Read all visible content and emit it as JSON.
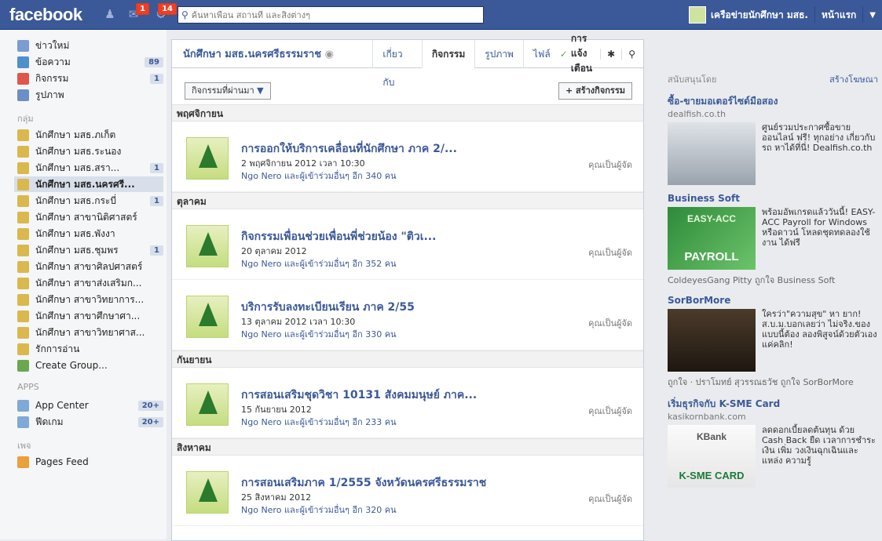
{
  "topbar": {
    "logo": "facebook",
    "friend_count": "",
    "messages_count": "1",
    "notifications_count": "14",
    "search_placeholder": "ค้นหาเพื่อน สถานที่ และสิ่งต่างๆ",
    "profile_name": "เครือข่ายนักศึกษา มสธ.",
    "home_label": "หน้าแรก"
  },
  "leftnav": {
    "items": [
      {
        "label": "ข่าวใหม่",
        "count": "",
        "icon": "news-feed-icon"
      },
      {
        "label": "ข้อความ",
        "count": "89",
        "icon": "messages-icon"
      },
      {
        "label": "กิจกรรม",
        "count": "1",
        "icon": "events-icon"
      },
      {
        "label": "รูปภาพ",
        "count": "",
        "icon": "photos-icon"
      }
    ],
    "groups_head": "กลุ่ม",
    "groups": [
      {
        "label": "นักศึกษา มสธ.ภเก็ต",
        "count": ""
      },
      {
        "label": "นักศึกษา มสธ.ระนอง",
        "count": ""
      },
      {
        "label": "นักศึกษา มสธ.สรา...",
        "count": "1"
      },
      {
        "label": "นักศึกษา มสธ.นครศรี...",
        "count": ""
      },
      {
        "label": "นักศึกษา มสธ.กระบี่",
        "count": "1"
      },
      {
        "label": "นักศึกษา สาขานิติศาสตร์",
        "count": ""
      },
      {
        "label": "นักศึกษา มสธ.พังงา",
        "count": ""
      },
      {
        "label": "นักศึกษา มสธ.ชุมพร",
        "count": "1"
      },
      {
        "label": "นักศึกษา สาขาศิลปศาสตร์",
        "count": ""
      },
      {
        "label": "นักศึกษา สาขาส่งเสริมก...",
        "count": ""
      },
      {
        "label": "นักศึกษา สาขาวิทยาการ...",
        "count": ""
      },
      {
        "label": "นักศึกษา สาขาศึกษาศา...",
        "count": ""
      },
      {
        "label": "นักศึกษา สาขาวิทยาศาส...",
        "count": ""
      },
      {
        "label": "รักการอ่าน",
        "count": ""
      },
      {
        "label": "Create Group...",
        "count": ""
      }
    ],
    "apps_head": "APPS",
    "apps": [
      {
        "label": "App Center",
        "count": "20+"
      },
      {
        "label": "ฟีดเกม",
        "count": "20+"
      }
    ],
    "pages_head": "เพจ",
    "pages": [
      {
        "label": "Pages Feed",
        "count": ""
      }
    ]
  },
  "main": {
    "page_title": "นักศึกษา มสธ.นครศรีธรรมราช",
    "tabs": [
      "เกี่ยวกับ",
      "กิจกรรม",
      "รูปภาพ",
      "ไฟล์"
    ],
    "notify_label": "การแจ้งเตือน",
    "filter_label": "กิจกรรมที่ผ่านมา",
    "create_label": "+ สร้างกิจกรรม",
    "months": [
      {
        "name": "พฤศจิกายน",
        "events": [
          {
            "title": "การออกให้บริการเคลื่อนที่นักศึกษา ภาค 2/...",
            "date": "2 พฤศจิกายน 2012 เวลา 10:30",
            "sub": "Ngo Nero และผู้เข้าร่วมอื่นๆ อีก 340 คน",
            "role": "คุณเป็นผู้จัด"
          }
        ]
      },
      {
        "name": "ตุลาคม",
        "events": [
          {
            "title": "กิจกรรมเพื่อนช่วยเพื่อนพี่ช่วยน้อง \"ติวเ...",
            "date": "20 ตุลาคม 2012",
            "sub": "Ngo Nero และผู้เข้าร่วมอื่นๆ อีก 352 คน",
            "role": "คุณเป็นผู้จัด"
          },
          {
            "title": "บริการรับลงทะเบียนเรียน ภาค 2/55",
            "date": "13 ตุลาคม 2012 เวลา 10:30",
            "sub": "Ngo Nero และผู้เข้าร่วมอื่นๆ อีก 330 คน",
            "role": "คุณเป็นผู้จัด"
          }
        ]
      },
      {
        "name": "กันยายน",
        "events": [
          {
            "title": "การสอนเสริมชุดวิชา 10131 สังคมมนุษย์ ภาค...",
            "date": "15 กันยายน 2012",
            "sub": "Ngo Nero และผู้เข้าร่วมอื่นๆ อีก 233 คน",
            "role": "คุณเป็นผู้จัด"
          }
        ]
      },
      {
        "name": "สิงหาคม",
        "events": [
          {
            "title": "การสอนเสริมภาค 1/2555 จังหวัดนครศรีธรรมราช",
            "date": "25 สิงหาคม 2012",
            "sub": "Ngo Nero และผู้เข้าร่วมอื่นๆ อีก 320 คน",
            "role": "คุณเป็นผู้จัด"
          }
        ]
      }
    ]
  },
  "right": {
    "sponsored": "สนับสนุนโดย",
    "create_ad": "สร้างโฆษณา",
    "ads": [
      {
        "title": "ซื้อ-ขายมอเตอร์ไซด์มือสอง",
        "site": "dealfish.co.th",
        "text": "ศูนย์รวมประกาศซื้อขาย ออนไลน์ ฟรี! ทุกอย่าง เกี่ยวกับรถ หาได้ที่นี่! Dealfish.co.th",
        "social": ""
      },
      {
        "title": "Business Soft",
        "site": "",
        "text": "พร้อมอัพเกรดแล้ววันนี้! EASY-ACC Payroll for Windows หรือดาวน์ โหลดชุดทดลองใช้งาน ได้ฟรี",
        "social": "ColdeyesGang Pitty ถูกใจ Business Soft",
        "img_label": "PAYROLL",
        "img_sub": "EASY-ACC"
      },
      {
        "title": "SorBorMore",
        "site": "",
        "text": "ใครว่า\"ความสุข\" หา ยาก!ส.บ.ม.บอกเลยว่า ไม่จริง.ของแบบนี้ต้อง ลองพิสูจน์ด้วยตัวเอง แค่คลิก!",
        "social": "ถูกใจ · ปราโมทย์ สุวรรณธวัช ถูกใจ SorBorMore"
      },
      {
        "title": "เริ่มธุรกิจกับ K-SME Card",
        "site": "kasikornbank.com",
        "text": "ลดดอกเบี้ยลดต้นทุน ด้วย Cash Back ยืด เวลาการชำระเงิน เพิ่ม วงเงินฉุกเฉินและแหล่ง ความรู้",
        "social": "",
        "img_label": "K-SME CARD",
        "img_sub": "KBank"
      }
    ]
  }
}
